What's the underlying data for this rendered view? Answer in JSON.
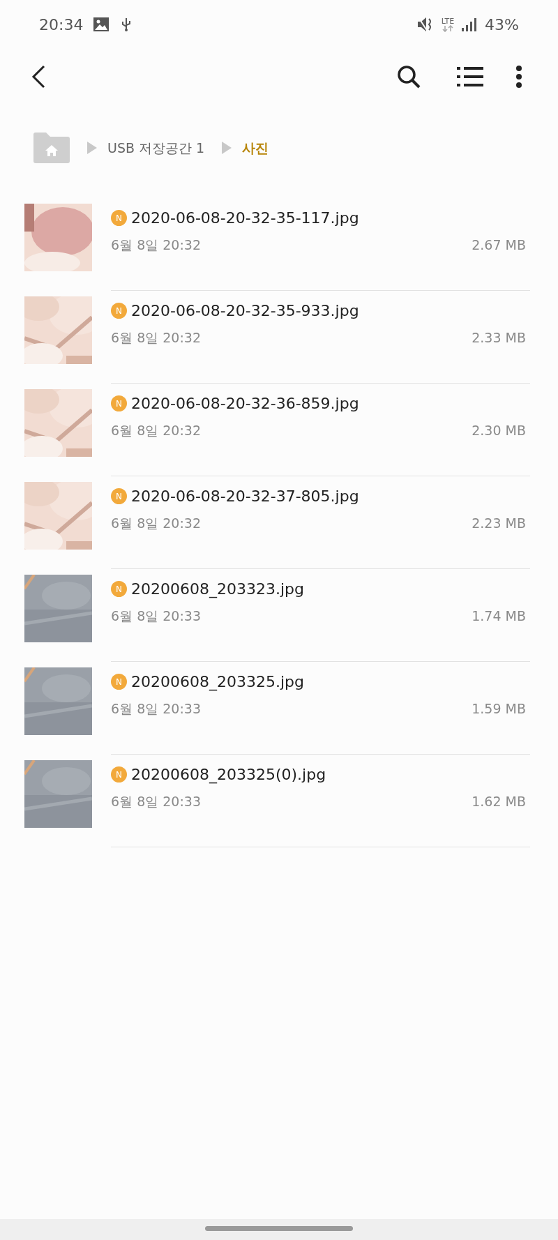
{
  "status_bar": {
    "time": "20:34",
    "battery": "43%",
    "network": "LTE"
  },
  "breadcrumb": [
    {
      "label": "USB 저장공간 1",
      "selected": false
    },
    {
      "label": "사진",
      "selected": true
    }
  ],
  "files": [
    {
      "name": "2020-06-08-20-32-35-117.jpg",
      "new": true,
      "date": "6월 8일 20:32",
      "size": "2.67 MB",
      "badge": "N"
    },
    {
      "name": "2020-06-08-20-32-35-933.jpg",
      "new": true,
      "date": "6월 8일 20:32",
      "size": "2.33 MB",
      "badge": "N"
    },
    {
      "name": "2020-06-08-20-32-36-859.jpg",
      "new": true,
      "date": "6월 8일 20:32",
      "size": "2.30 MB",
      "badge": "N"
    },
    {
      "name": "2020-06-08-20-32-37-805.jpg",
      "new": true,
      "date": "6월 8일 20:32",
      "size": "2.23 MB",
      "badge": "N"
    },
    {
      "name": "20200608_203323.jpg",
      "new": true,
      "date": "6월 8일 20:33",
      "size": "1.74 MB",
      "badge": "N"
    },
    {
      "name": "20200608_203325.jpg",
      "new": true,
      "date": "6월 8일 20:33",
      "size": "1.59 MB",
      "badge": "N"
    },
    {
      "name": "20200608_203325(0).jpg",
      "new": true,
      "date": "6월 8일 20:33",
      "size": "1.62 MB",
      "badge": "N"
    }
  ]
}
